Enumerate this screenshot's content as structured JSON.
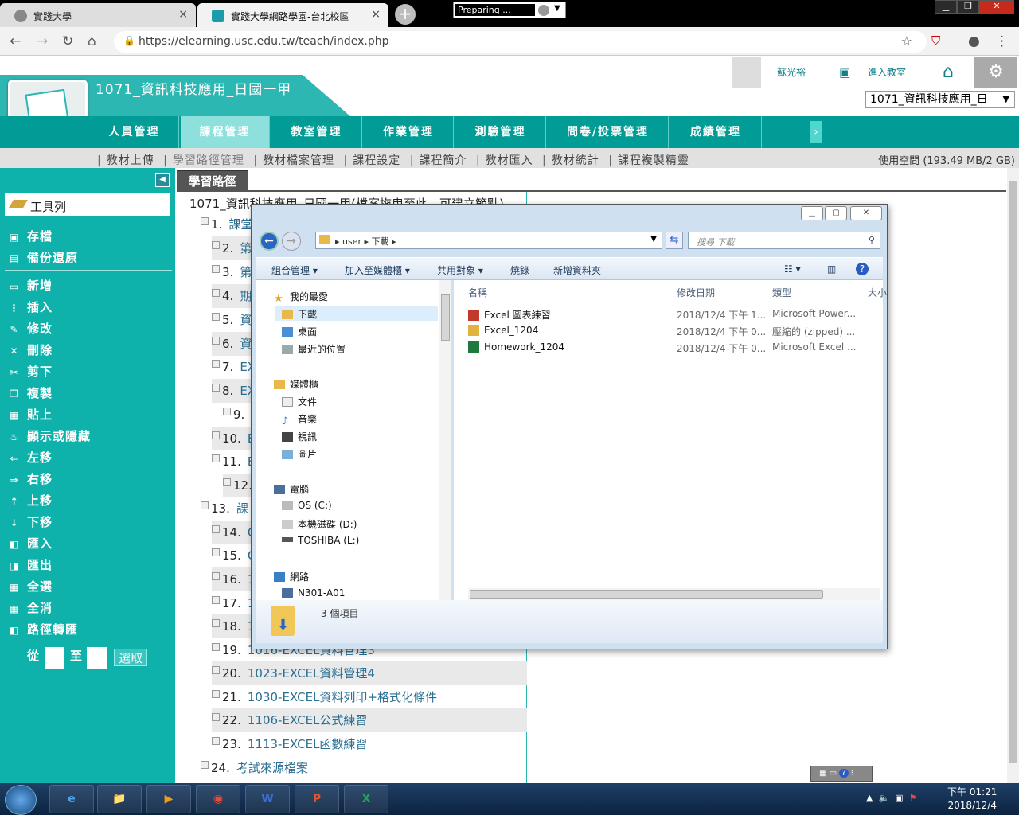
{
  "browser": {
    "tabs": [
      {
        "title": "實踐大學",
        "close": "×"
      },
      {
        "title": "實踐大學網路學園-台北校區",
        "close": "×"
      }
    ],
    "new_tab": "+",
    "status_preparing": "Preparing ...",
    "url": "https://elearning.usc.edu.tw/teach/index.php",
    "window_buttons": [
      "▁",
      "❐",
      "✕"
    ]
  },
  "site": {
    "course_title": "1071_資訊科技應用_日國一甲",
    "user_name": "蘇光裕",
    "enter_classroom": "進入教室",
    "course_select": "1071_資訊科技應用_日",
    "nav": [
      "人員管理",
      "課程管理",
      "教室管理",
      "作業管理",
      "測驗管理",
      "問卷/投票管理",
      "成績管理"
    ],
    "nav_active": 1,
    "nav_more": "›",
    "subnav": [
      "教材上傳",
      "學習路徑管理",
      "教材檔案管理",
      "課程設定",
      "課程簡介",
      "教材匯入",
      "教材統計",
      "課程複製精靈"
    ],
    "space_used": "使用空間 (193.49 MB/2 GB)"
  },
  "toolbar": {
    "title": "工具列",
    "items_top": [
      "存檔",
      "備份還原"
    ],
    "items": [
      "新增",
      "插入",
      "修改",
      "刪除",
      "剪下",
      "複製",
      "貼上",
      "顯示或隱藏",
      "左移",
      "右移",
      "上移",
      "下移",
      "匯入",
      "匯出",
      "全選",
      "全消",
      "路徑轉匯"
    ],
    "from": "從",
    "to": "至",
    "pick": "選取"
  },
  "path": {
    "tab": "學習路徑",
    "header": "1071_資訊科技應用_日國一甲(檔案拖曳至此，可建立節點)",
    "rows": [
      {
        "n": "1.",
        "label": "課堂"
      },
      {
        "n": "2.",
        "label": "第"
      },
      {
        "n": "3.",
        "label": "第"
      },
      {
        "n": "4.",
        "label": "期"
      },
      {
        "n": "5.",
        "label": "資"
      },
      {
        "n": "6.",
        "label": "資"
      },
      {
        "n": "7.",
        "label": "EX"
      },
      {
        "n": "8.",
        "label": "EX"
      },
      {
        "n": "9.",
        "label": ""
      },
      {
        "n": "10.",
        "label": "E"
      },
      {
        "n": "11.",
        "label": "E"
      },
      {
        "n": "12.",
        "label": ""
      },
      {
        "n": "13.",
        "label": "課"
      },
      {
        "n": "14.",
        "label": "C"
      },
      {
        "n": "15.",
        "label": "C"
      },
      {
        "n": "16.",
        "label": "1"
      },
      {
        "n": "17.",
        "label": "1"
      },
      {
        "n": "18.",
        "label": "1"
      },
      {
        "n": "19.",
        "label": "1016-EXCEL資料管理3"
      },
      {
        "n": "20.",
        "label": "1023-EXCEL資料管理4"
      },
      {
        "n": "21.",
        "label": "1030-EXCEL資料列印+格式化條件"
      },
      {
        "n": "22.",
        "label": "1106-EXCEL公式練習"
      },
      {
        "n": "23.",
        "label": "1113-EXCEL函數練習"
      },
      {
        "n": "24.",
        "label": "考試來源檔案"
      }
    ]
  },
  "explorer": {
    "breadcrumb": [
      "user",
      "下載"
    ],
    "search_placeholder": "搜尋 下載",
    "toolbar": [
      "組合管理 ▾",
      "加入至媒體櫃 ▾",
      "共用對象 ▾",
      "燒錄",
      "新增資料夾"
    ],
    "nav": {
      "favorites": "我的最愛",
      "fav_items": [
        "下載",
        "桌面",
        "最近的位置"
      ],
      "libraries": "媒體櫃",
      "lib_items": [
        "文件",
        "音樂",
        "視訊",
        "圖片"
      ],
      "computer": "電腦",
      "comp_items": [
        "OS (C:)",
        "本機磁碟 (D:)",
        "TOSHIBA (L:)"
      ],
      "network": "網路",
      "net_items": [
        "N301-A01"
      ]
    },
    "columns": [
      "名稱",
      "修改日期",
      "類型",
      "大小"
    ],
    "files": [
      {
        "name": "Excel 圖表練習",
        "date": "2018/12/4 下午 1...",
        "type": "Microsoft Power...",
        "color": "#c0392b"
      },
      {
        "name": "Excel_1204",
        "date": "2018/12/4 下午 0...",
        "type": "壓縮的 (zipped) ...",
        "color": "#e2b33c"
      },
      {
        "name": "Homework_1204",
        "date": "2018/12/4 下午 0...",
        "type": "Microsoft Excel ...",
        "color": "#1e7a3c"
      }
    ],
    "status": "3 個項目"
  },
  "taskbar": {
    "apps": [
      "e",
      "📁",
      "▶",
      "◉",
      "W",
      "P",
      "X"
    ],
    "time": "下午 01:21",
    "date": "2018/12/4"
  },
  "colors": {
    "teal": "#0fb1ab",
    "teal_dark": "#009c95",
    "link": "#2a6f92"
  }
}
